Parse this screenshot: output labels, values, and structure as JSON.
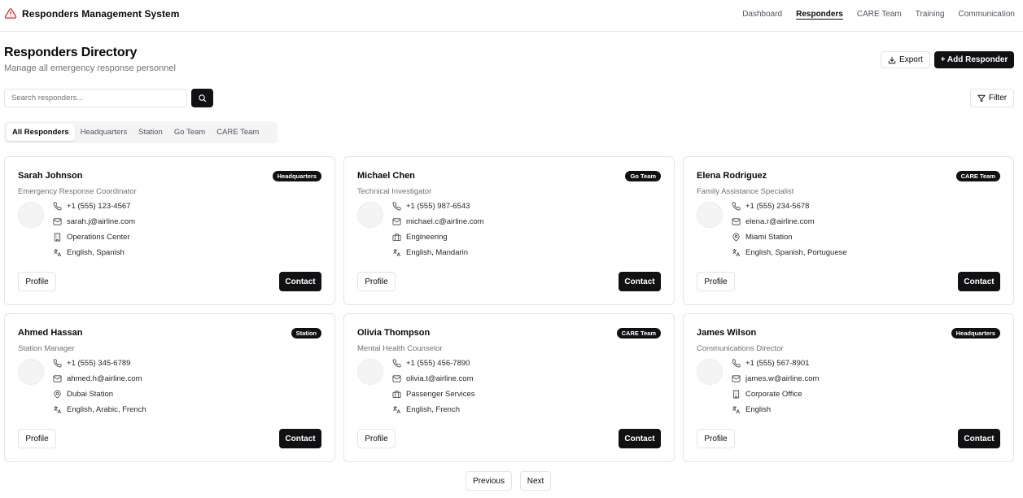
{
  "app": {
    "title": "Responders Management System",
    "logo_icon": "alert-triangle-icon",
    "accent": "#dc2626"
  },
  "nav": {
    "items": [
      "Dashboard",
      "Responders",
      "CARE Team",
      "Training",
      "Communication"
    ],
    "active": "Responders"
  },
  "header": {
    "title": "Responders Directory",
    "subtitle": "Manage all emergency response personnel",
    "export_label": "Export",
    "add_label": "+ Add Responder"
  },
  "search": {
    "placeholder": "Search responders...",
    "value": ""
  },
  "filter_label": "Filter",
  "tabs": {
    "items": [
      "All Responders",
      "Headquarters",
      "Station",
      "Go Team",
      "CARE Team"
    ],
    "active": "All Responders"
  },
  "cards": [
    {
      "name": "Sarah Johnson",
      "role": "Emergency Response Coordinator",
      "badge": "Headquarters",
      "phone": "+1 (555) 123-4567",
      "email": "sarah.j@airline.com",
      "location": "Operations Center",
      "location_icon": "building-icon",
      "languages": "English, Spanish"
    },
    {
      "name": "Michael Chen",
      "role": "Technical Investigator",
      "badge": "Go Team",
      "phone": "+1 (555) 987-6543",
      "email": "michael.c@airline.com",
      "location": "Engineering",
      "location_icon": "briefcase-icon",
      "languages": "English, Mandarin"
    },
    {
      "name": "Elena Rodriguez",
      "role": "Family Assistance Specialist",
      "badge": "CARE Team",
      "phone": "+1 (555) 234-5678",
      "email": "elena.r@airline.com",
      "location": "Miami Station",
      "location_icon": "map-pin-icon",
      "languages": "English, Spanish, Portuguese"
    },
    {
      "name": "Ahmed Hassan",
      "role": "Station Manager",
      "badge": "Station",
      "phone": "+1 (555) 345-6789",
      "email": "ahmed.h@airline.com",
      "location": "Dubai Station",
      "location_icon": "map-pin-icon",
      "languages": "English, Arabic, French"
    },
    {
      "name": "Olivia Thompson",
      "role": "Mental Health Counselor",
      "badge": "CARE Team",
      "phone": "+1 (555) 456-7890",
      "email": "olivia.t@airline.com",
      "location": "Passenger Services",
      "location_icon": "briefcase-icon",
      "languages": "English, French"
    },
    {
      "name": "James Wilson",
      "role": "Communications Director",
      "badge": "Headquarters",
      "phone": "+1 (555) 567-8901",
      "email": "james.w@airline.com",
      "location": "Corporate Office",
      "location_icon": "building-icon",
      "languages": "English"
    }
  ],
  "card_actions": {
    "profile_label": "Profile",
    "contact_label": "Contact"
  },
  "pagination": {
    "previous_label": "Previous",
    "next_label": "Next"
  }
}
